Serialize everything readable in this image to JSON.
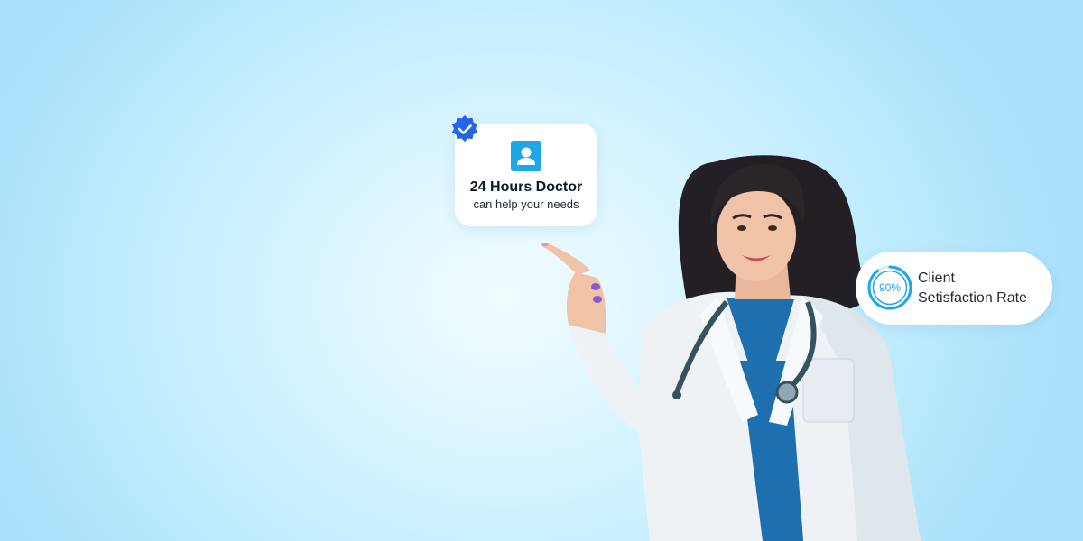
{
  "doctor_card": {
    "title": "24 Hours Doctor",
    "subtitle": "can help your needs",
    "icon": "person-icon",
    "badge_icon": "verified-check-icon"
  },
  "satisfaction_card": {
    "percent_label": "90%",
    "rate_fraction": 0.9,
    "label_line1": "Client",
    "label_line2": "Setisfaction Rate"
  },
  "colors": {
    "accent": "#1ea7e8",
    "badge": "#2563eb",
    "scrubs": "#1d6fb0",
    "background_light": "#f2fcff",
    "background_edge": "#a9e0fb"
  }
}
